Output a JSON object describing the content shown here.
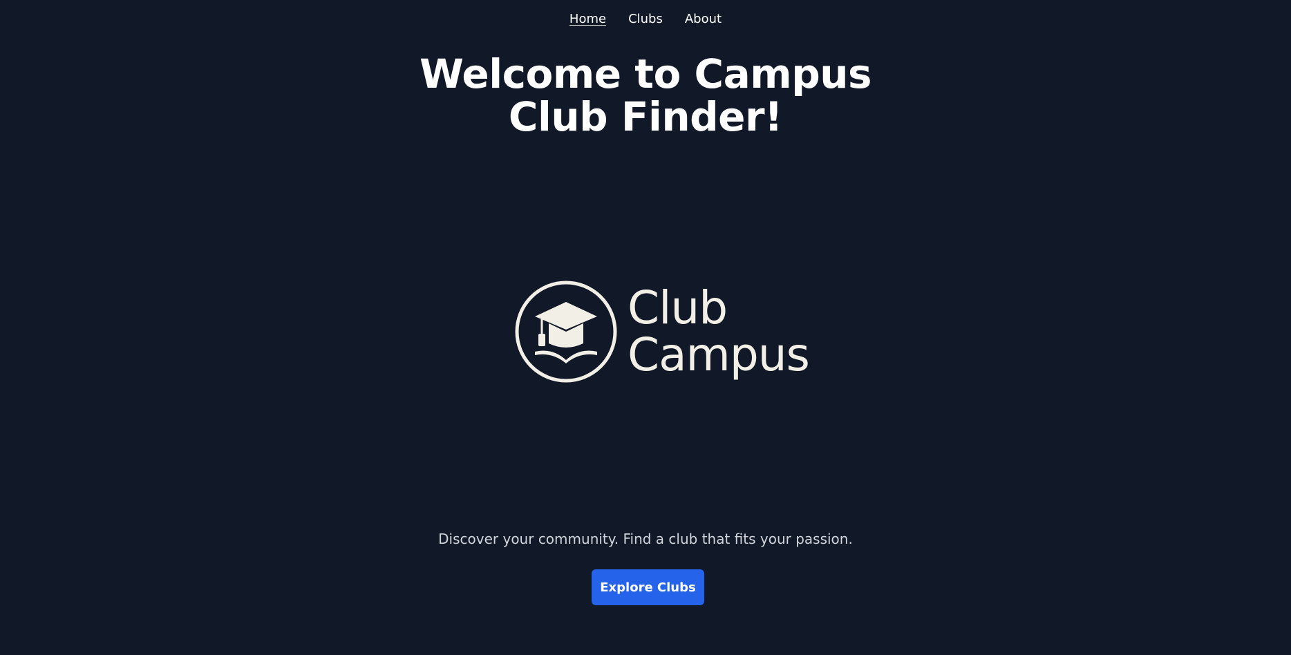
{
  "nav": {
    "items": [
      {
        "label": "Home",
        "active": true
      },
      {
        "label": "Clubs",
        "active": false
      },
      {
        "label": "About",
        "active": false
      }
    ]
  },
  "hero": {
    "title_line1": "Welcome to Campus",
    "title_line2": "Club Finder!"
  },
  "logo": {
    "line1": "Club",
    "line2": "Campus",
    "icon": "graduation-cap-book-icon"
  },
  "tagline": "Discover your community. Find a club that fits your passion.",
  "cta": {
    "label": "Explore Clubs"
  },
  "colors": {
    "background": "#111827",
    "accent": "#2563eb",
    "logo": "#f2efe6",
    "tagline": "#d1d5db"
  }
}
